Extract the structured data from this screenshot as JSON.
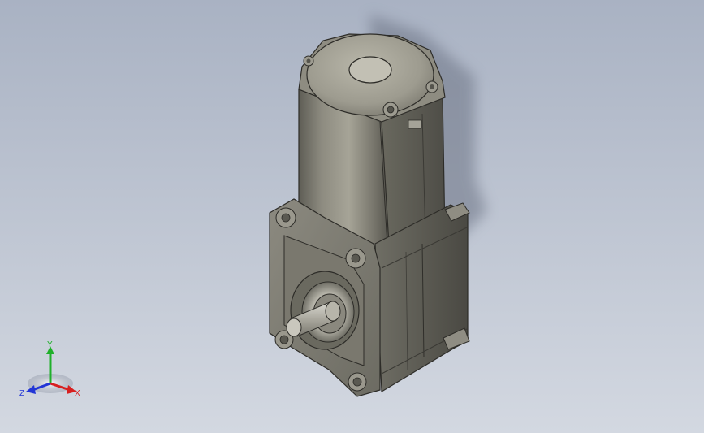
{
  "viewport": {
    "background_top": "#a9b2c3",
    "background_bottom": "#d3d8e1"
  },
  "model": {
    "subject": "gearmotor",
    "body_color": "#7d7b70",
    "shadow_color": "#6c7384"
  },
  "triad": {
    "x_label": "X",
    "y_label": "Y",
    "z_label": "Z",
    "x_color": "#d81f1f",
    "y_color": "#1fb02a",
    "z_color": "#2336d6"
  }
}
